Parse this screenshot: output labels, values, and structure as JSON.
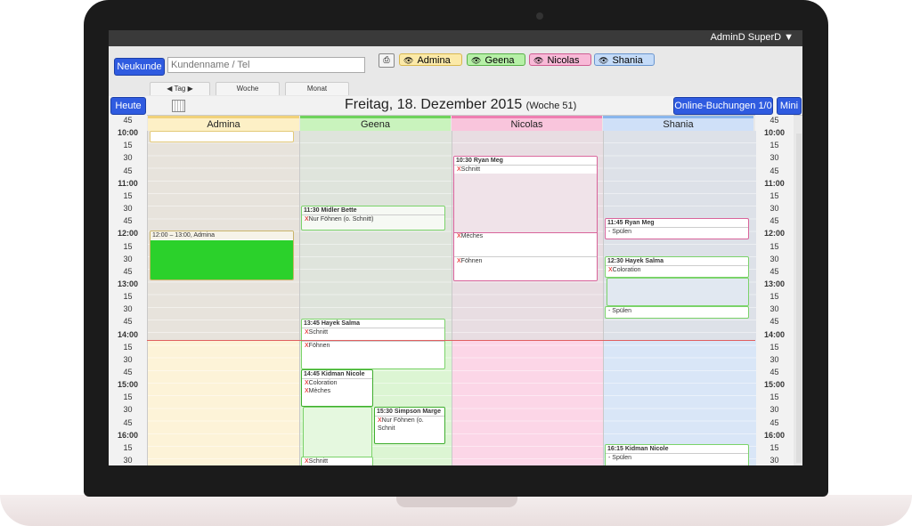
{
  "user_menu": "AdminD SuperD ▼",
  "toolbar": {
    "new_customer": "Neukunde",
    "search_placeholder": "Kundenname / Tel",
    "print_icon": "printer-icon",
    "staff": [
      "Admina",
      "Geena",
      "Nicolas",
      "Shania"
    ]
  },
  "colors": {
    "Admina": "#f7dd8d",
    "Geena": "#8fe07f",
    "Nicolas": "#f49ac4",
    "Shania": "#a9c9f3"
  },
  "tabs": {
    "prev": "◀",
    "day": "Tag",
    "next": "▶",
    "week": "Woche",
    "month": "Monat"
  },
  "datebar": {
    "today": "Heute",
    "date": "Freitag, 18. Dezember 2015",
    "week": "(Woche 51)",
    "online": "Online-Buchungen 1/0",
    "mini": "Mini"
  },
  "columns": [
    "Admina",
    "Geena",
    "Nicolas",
    "Shania"
  ],
  "times": [
    "45",
    "10:00",
    "15",
    "30",
    "45",
    "11:00",
    "15",
    "30",
    "45",
    "12:00",
    "15",
    "30",
    "45",
    "13:00",
    "15",
    "30",
    "45",
    "14:00",
    "15",
    "30",
    "45",
    "15:00",
    "15",
    "30",
    "45",
    "16:00",
    "15",
    "30"
  ],
  "appointments": {
    "a_admina": {
      "title": "12:00 – 13:00, Admina"
    },
    "g1": {
      "title": "11:30 Midler Bette",
      "svc": "Nur Föhnen (o. Schnitt)"
    },
    "g2": {
      "title": "13:45 Hayek Salma",
      "svc1": "Schnitt",
      "svc2": "Föhnen"
    },
    "g3": {
      "title": "14:45 Kidman Nicole",
      "svc1": "Coloration",
      "svc2": "Mèches"
    },
    "g4": {
      "title": "15:30 Simpson Marge",
      "svc": "Nur Föhnen (o. Schnit"
    },
    "g5": {
      "svc": "Schnitt"
    },
    "n1": {
      "title": "10:30 Ryan Meg",
      "svc1": "Mèches",
      "svc2": "Schnitt",
      "svc3": "Föhnen"
    },
    "s1": {
      "title": "11:45 Ryan Meg",
      "svc": "- Spülen"
    },
    "s2": {
      "title": "12:30 Hayek Salma",
      "svc1": "Coloration",
      "svc2": "- Spülen"
    },
    "s3": {
      "title": "16:15 Kidman Nicole",
      "svc": "- Spülen"
    }
  }
}
